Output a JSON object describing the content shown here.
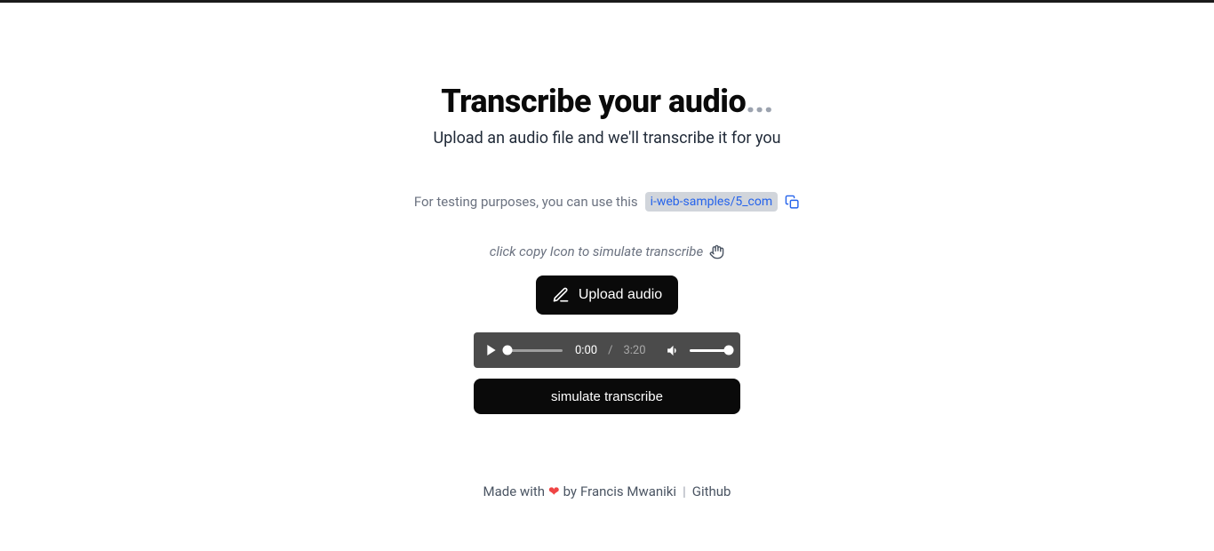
{
  "header": {
    "title": "Transcribe your audio",
    "title_dots": "...",
    "subtitle": "Upload an audio file and we'll transcribe it for you"
  },
  "test": {
    "intro": "For testing purposes, you can use this",
    "sample_text": "i-web-samples/5_com",
    "hint": "click copy Icon to simulate transcribe"
  },
  "upload": {
    "label": "Upload audio"
  },
  "player": {
    "current": "0:00",
    "separator": "/",
    "total": "3:20"
  },
  "simulate": {
    "label": "simulate transcribe"
  },
  "footer": {
    "made_with": "Made with",
    "heart": "❤",
    "by": "by",
    "author": "Francis Mwaniki",
    "separator": "|",
    "github": "Github"
  }
}
